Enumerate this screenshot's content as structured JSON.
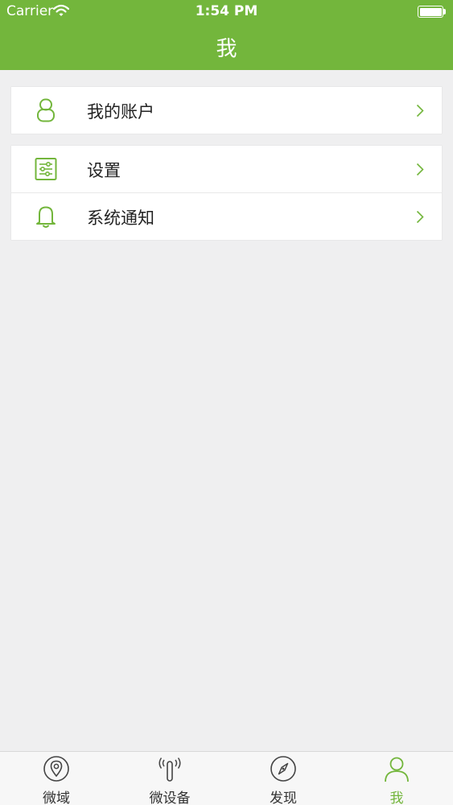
{
  "status_bar": {
    "carrier": "Carrier",
    "time": "1:54 PM",
    "wifi_icon": "wifi-icon",
    "battery_icon": "battery-icon"
  },
  "nav": {
    "title": "我"
  },
  "menu": {
    "account": {
      "label": "我的账户",
      "icon": "user-icon"
    },
    "settings": {
      "label": "设置",
      "icon": "sliders-icon"
    },
    "notifications": {
      "label": "系统通知",
      "icon": "bell-icon"
    }
  },
  "tabs": [
    {
      "label": "微域",
      "icon": "location-pin-icon",
      "active": false
    },
    {
      "label": "微设备",
      "icon": "signal-device-icon",
      "active": false
    },
    {
      "label": "发现",
      "icon": "compass-icon",
      "active": false
    },
    {
      "label": "我",
      "icon": "person-icon",
      "active": true
    }
  ],
  "colors": {
    "accent": "#73b63c",
    "background": "#efeff0",
    "tab_inactive": "#333333"
  }
}
